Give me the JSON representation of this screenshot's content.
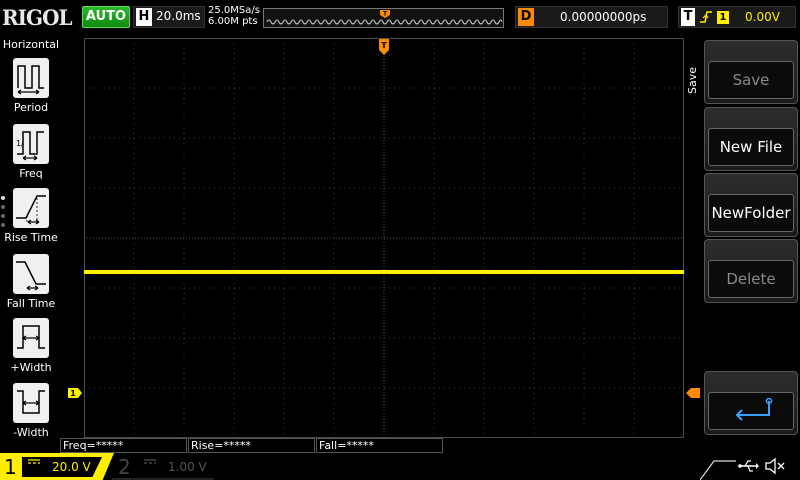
{
  "top": {
    "logo": "RIGOL",
    "run_state": "AUTO",
    "horizontal_letter": "H",
    "timebase": "20.0ms",
    "sample_rate": "25.0MSa/s",
    "memory_depth": "6.00M pts",
    "trigger_marker": "T",
    "delay_letter": "D",
    "delay_value": "0.00000000ps",
    "trigger_letter": "T",
    "trigger_source": "1",
    "trigger_level": "0.00V"
  },
  "left_menu": {
    "title": "Horizontal",
    "items": [
      {
        "label": "Period",
        "icon": "period-icon"
      },
      {
        "label": "Freq",
        "icon": "frequency-icon"
      },
      {
        "label": "Rise Time",
        "icon": "rise-time-icon"
      },
      {
        "label": "Fall Time",
        "icon": "fall-time-icon"
      },
      {
        "label": "+Width",
        "icon": "positive-width-icon"
      },
      {
        "label": "-Width",
        "icon": "negative-width-icon"
      }
    ]
  },
  "grid": {
    "trace_color": "#ffee00",
    "trigger_marker_color": "#ff8a00",
    "ch1_marker": "1",
    "trigger_top_marker": "T"
  },
  "measurements": [
    {
      "label": "Freq=*****"
    },
    {
      "label": "Rise=*****"
    },
    {
      "label": "Fall=*****"
    }
  ],
  "right_menu": {
    "title": "Save",
    "buttons": [
      {
        "label": "Save",
        "enabled": false
      },
      {
        "label": "New File",
        "enabled": true
      },
      {
        "label": "NewFolder",
        "enabled": true
      },
      {
        "label": "Delete",
        "enabled": false
      },
      {
        "label": "",
        "icon": "return-icon",
        "enabled": true
      }
    ]
  },
  "bottom": {
    "ch1_number": "1",
    "ch1_coupling": "DC",
    "ch1_scale": "20.0 V",
    "ch2_number": "2",
    "ch2_coupling": "DC",
    "ch2_scale": "1.00 V",
    "usb_icon": "usb-icon",
    "mute_icon": "speaker-mute-icon"
  }
}
